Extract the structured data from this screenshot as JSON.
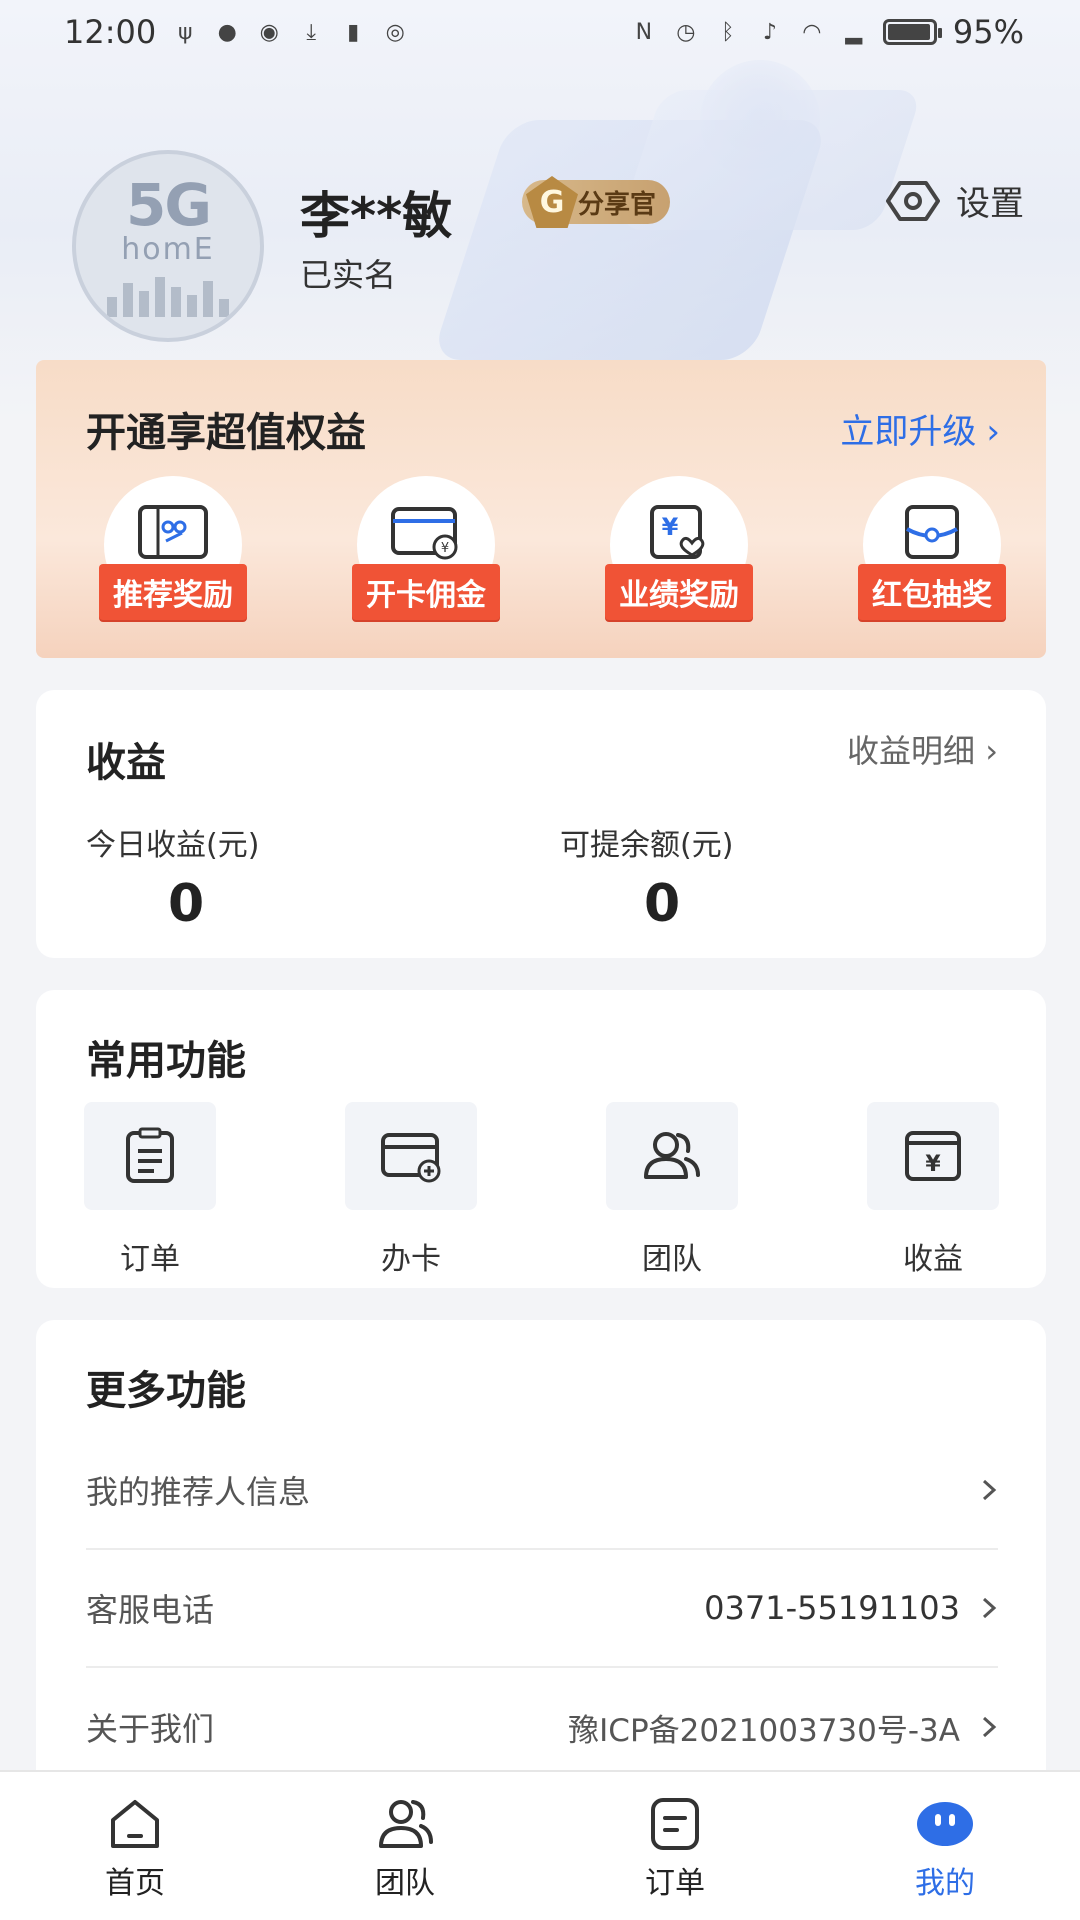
{
  "status_bar": {
    "time": "12:00",
    "battery": "95%",
    "left_icons": [
      "usb-icon",
      "notification-bell-icon",
      "browser-icon",
      "download-icon",
      "sim-icon",
      "eye-icon"
    ],
    "right_icons": [
      "nfc-icon",
      "alarm-icon",
      "bluetooth-icon",
      "mute-icon",
      "wifi-icon",
      "signal-icon",
      "battery-icon"
    ]
  },
  "profile": {
    "avatar_text_top": "5G",
    "avatar_text_bottom": "homE",
    "name": "李**敏",
    "badge": "分享官",
    "badge_letter": "G",
    "status": "已实名",
    "settings_label": "设置"
  },
  "upgrade": {
    "title": "开通享超值权益",
    "link": "立即升级",
    "benefits": [
      {
        "label": "推荐奖励",
        "icon": "referral-card-icon"
      },
      {
        "label": "开卡佣金",
        "icon": "card-commission-icon"
      },
      {
        "label": "业绩奖励",
        "icon": "performance-reward-icon"
      },
      {
        "label": "红包抽奖",
        "icon": "red-envelope-icon"
      }
    ]
  },
  "income": {
    "title": "收益",
    "detail_link": "收益明细",
    "today_label": "今日收益(元)",
    "today_value": "0",
    "balance_label": "可提余额(元)",
    "balance_value": "0"
  },
  "common": {
    "title": "常用功能",
    "items": [
      {
        "label": "订单",
        "icon": "clipboard-icon"
      },
      {
        "label": "办卡",
        "icon": "add-card-icon"
      },
      {
        "label": "团队",
        "icon": "team-icon"
      },
      {
        "label": "收益",
        "icon": "yuan-wallet-icon"
      }
    ]
  },
  "more": {
    "title": "更多功能",
    "rows": [
      {
        "label": "我的推荐人信息",
        "value": ""
      },
      {
        "label": "客服电话",
        "value": "0371-55191103"
      },
      {
        "label": "关于我们",
        "value": "豫ICP备2021003730号-3A"
      }
    ]
  },
  "nav": {
    "items": [
      {
        "label": "首页",
        "icon": "home-icon"
      },
      {
        "label": "团队",
        "icon": "team-icon"
      },
      {
        "label": "订单",
        "icon": "order-icon"
      },
      {
        "label": "我的",
        "icon": "profile-face-icon"
      }
    ],
    "active": "我的"
  },
  "colors": {
    "accent": "#2e6ee6",
    "tag_red": "#f05336",
    "badge_gold": "#c7a170"
  }
}
